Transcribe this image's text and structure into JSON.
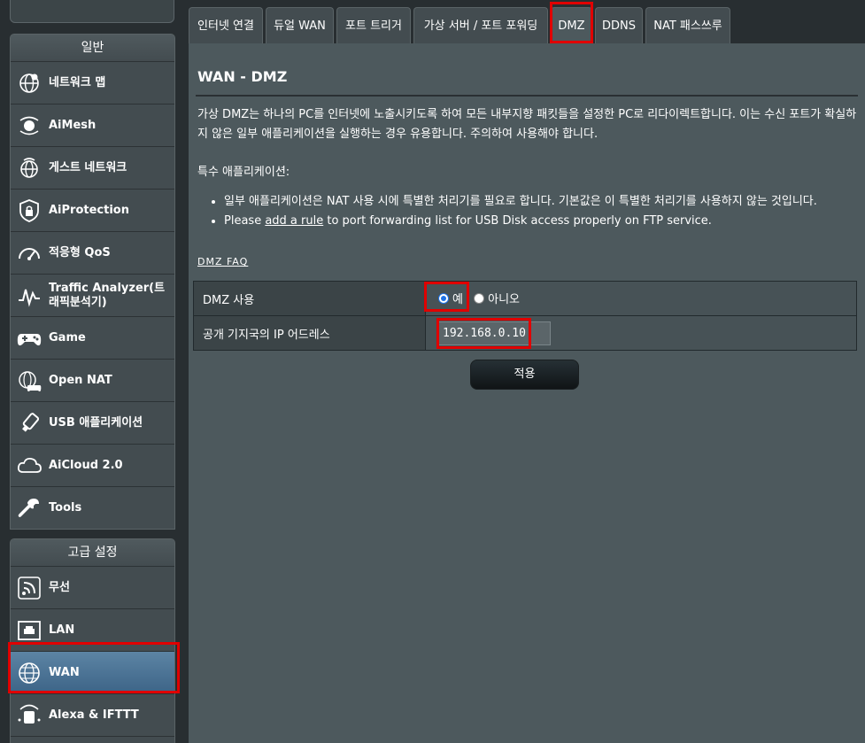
{
  "sidebar": {
    "general_header": "일반",
    "advanced_header": "고급 설정",
    "general_items": [
      {
        "label": "네트워크 맵"
      },
      {
        "label": "AiMesh"
      },
      {
        "label": "게스트 네트워크"
      },
      {
        "label": "AiProtection"
      },
      {
        "label": "적응형 QoS"
      },
      {
        "label": "Traffic Analyzer(트래픽분석기)"
      },
      {
        "label": "Game"
      },
      {
        "label": "Open NAT"
      },
      {
        "label": "USB 애플리케이션"
      },
      {
        "label": "AiCloud 2.0"
      },
      {
        "label": "Tools"
      }
    ],
    "advanced_items": [
      {
        "label": "무선"
      },
      {
        "label": "LAN"
      },
      {
        "label": "WAN"
      },
      {
        "label": "Alexa & IFTTT"
      }
    ],
    "active_item": "WAN"
  },
  "tabs": [
    {
      "label": "인터넷 연결"
    },
    {
      "label": "듀얼 WAN"
    },
    {
      "label": "포트 트리거"
    },
    {
      "label": "가상 서버 / 포트 포워딩"
    },
    {
      "label": "DMZ"
    },
    {
      "label": "DDNS"
    },
    {
      "label": "NAT 패스쓰루"
    }
  ],
  "active_tab": "DMZ",
  "main": {
    "title": "WAN - DMZ",
    "description": "가상 DMZ는 하나의 PC를 인터넷에 노출시키도록 하여 모든 내부지향 패킷들을 설정한 PC로 리다이렉트합니다. 이는 수신 포트가 확실하지 않은 일부 애플리케이션을 실행하는 경우 유용합니다. 주의하여 사용해야 합니다.",
    "special_title": "특수 애플리케이션:",
    "bullet1": "일부 애플리케이션은 NAT 사용 시에 특별한 처리기를 필요로 합니다. 기본값은 이 특별한 처리기를 사용하지 않는 것입니다.",
    "bullet2_prefix": "Please ",
    "bullet2_link": "add a rule",
    "bullet2_suffix": " to port forwarding list for USB Disk access properly on FTP service.",
    "faq_link": "DMZ FAQ",
    "form": {
      "dmz_enable_label": "DMZ 사용",
      "yes_label": "예",
      "no_label": "아니오",
      "dmz_enabled": true,
      "ip_label": "공개 기지국의 IP 어드레스",
      "ip_value": "192.168.0.10"
    },
    "apply_label": "적용"
  },
  "colors": {
    "highlight": "#e00000",
    "active_item": "#4a7396",
    "panel": "#4d595d",
    "sidebar_item": "#434c50"
  }
}
